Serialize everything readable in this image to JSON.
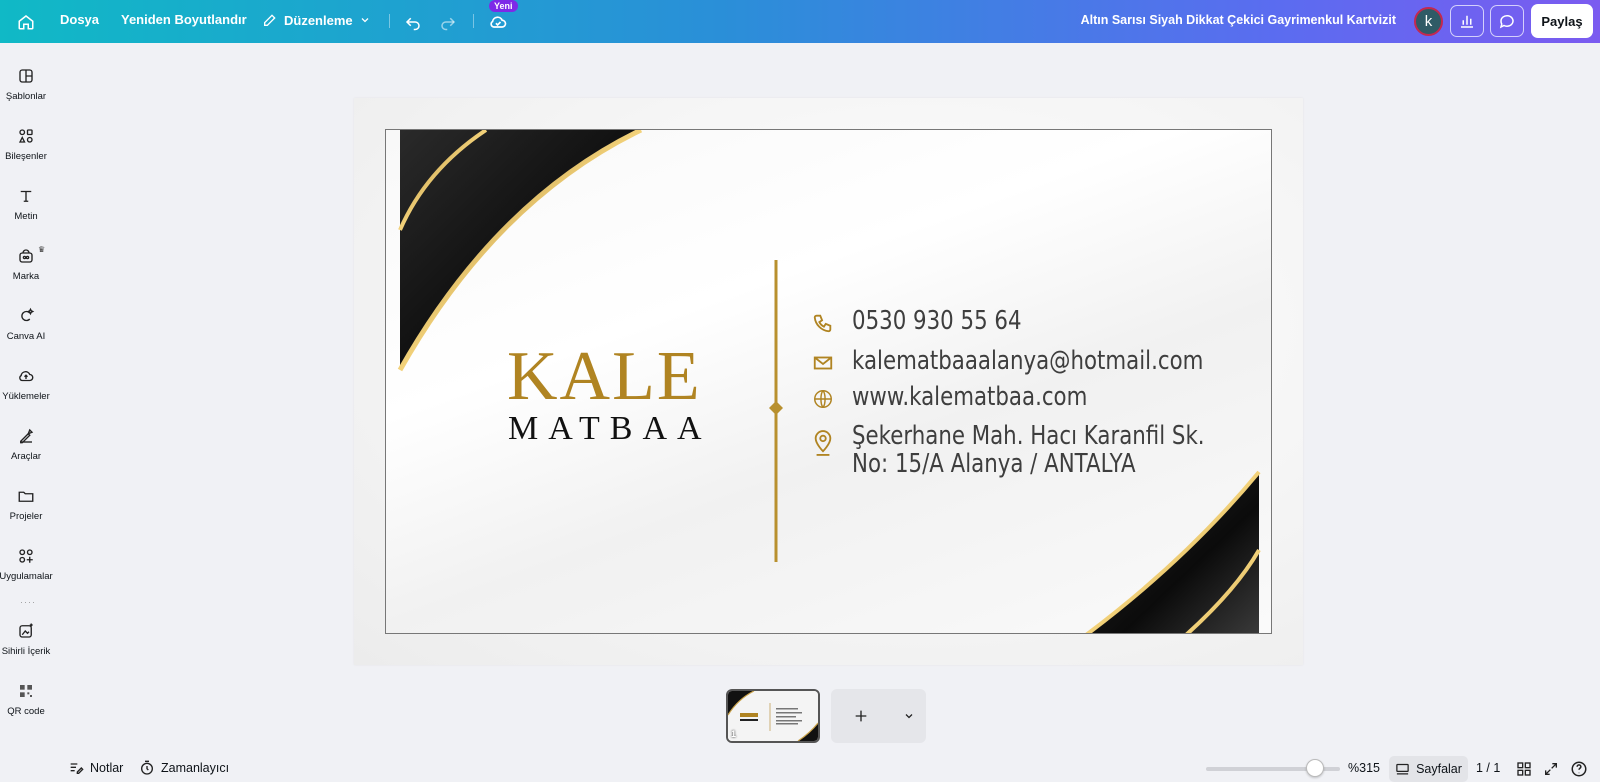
{
  "topbar": {
    "file": "Dosya",
    "resize": "Yeniden Boyutlandır",
    "edit": "Düzenleme",
    "new_badge": "Yeni",
    "doc_title": "Altın Sarısı Siyah Dikkat Çekici Gayrimenkul Kartvizit",
    "avatar_letter": "k",
    "share": "Paylaş"
  },
  "sidebar": {
    "items": [
      {
        "label": "Şablonlar",
        "icon": "templates-icon"
      },
      {
        "label": "Bileşenler",
        "icon": "elements-icon"
      },
      {
        "label": "Metin",
        "icon": "text-icon"
      },
      {
        "label": "Marka",
        "icon": "brand-icon"
      },
      {
        "label": "Canva AI",
        "icon": "canva-ai-icon"
      },
      {
        "label": "Yüklemeler",
        "icon": "upload-icon"
      },
      {
        "label": "Araçlar",
        "icon": "tools-icon"
      },
      {
        "label": "Projeler",
        "icon": "folder-icon"
      },
      {
        "label": "Uygulamalar",
        "icon": "apps-icon"
      },
      {
        "label": "Sihirli İçerik",
        "icon": "magic-media-icon"
      },
      {
        "label": "QR code",
        "icon": "qr-code-icon"
      }
    ]
  },
  "card": {
    "brand_top": "KALE",
    "brand_bottom": "MATBAA",
    "phone": "0530 930 55 64",
    "email": "kalematbaaalanya@hotmail.com",
    "website": "www.kalematbaa.com",
    "address_line1": "Şekerhane Mah. Hacı Karanfil Sk.",
    "address_line2": "No: 15/A Alanya / ANTALYA",
    "gold": "#b08422",
    "black": "#121212"
  },
  "pages": {
    "thumb_number": "1"
  },
  "footer": {
    "notes": "Notlar",
    "timer": "Zamanlayıcı",
    "zoom": "%315",
    "zoom_level": 315,
    "pages_label": "Sayfalar",
    "page_count": "1 / 1"
  }
}
